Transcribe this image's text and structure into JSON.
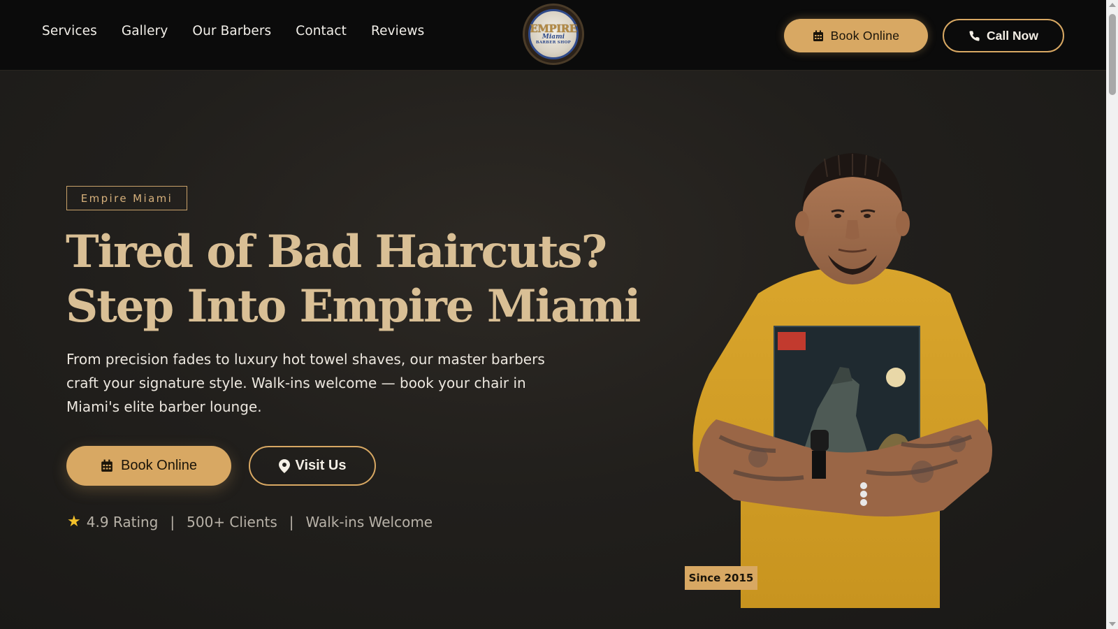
{
  "nav": {
    "links": [
      "Services",
      "Gallery",
      "Our Barbers",
      "Contact",
      "Reviews"
    ],
    "logo": {
      "main": "EMPIRE",
      "script": "Miami",
      "sub": "BARBER SHOP"
    },
    "book_label": "Book Online",
    "call_label": "Call Now"
  },
  "hero": {
    "tag": "Empire Miami",
    "headline": "Tired of Bad Haircuts? Step Into Empire Miami",
    "subtext": "From precision fades to luxury hot towel shaves, our master barbers craft your signature style. Walk-ins welcome — book your chair in Miami's elite barber lounge.",
    "book_label": "Book Online",
    "visit_label": "Visit Us",
    "stats": {
      "rating": "4.9 Rating",
      "separator": "|",
      "clients": "500+ Clients",
      "walkins": "Walk-ins Welcome"
    },
    "since_badge": "Since 2015"
  },
  "colors": {
    "accent": "#d8a863",
    "headline": "#d9bf95",
    "nav_bg": "#0b0b0b",
    "page_bg": "#211f1c",
    "star": "#f3c12b"
  },
  "icons": {
    "calendar": "calendar-icon",
    "phone": "phone-icon",
    "pin": "map-pin-icon",
    "star": "star-icon"
  }
}
